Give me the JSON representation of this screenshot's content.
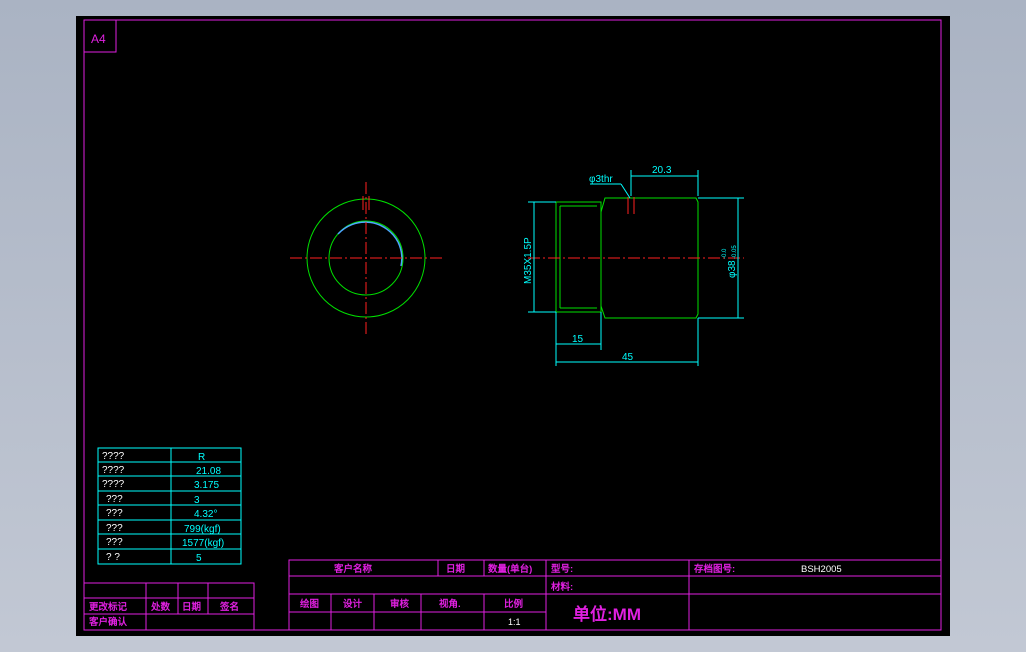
{
  "sheet": {
    "size_label": "A4"
  },
  "drawing": {
    "dim_thread_hole": "φ3thr",
    "dim_offset": "20.3",
    "dim_thread": "M35X1.5P",
    "dim_diameter": "φ38",
    "dim_tol_upper": "-0.0",
    "dim_tol_lower": "-0.05",
    "dim_len_small": "15",
    "dim_len_total": "45"
  },
  "spec_table": {
    "rows": [
      {
        "label": "????",
        "value": "R"
      },
      {
        "label": "????",
        "value": "21.08"
      },
      {
        "label": "????",
        "value": "3.175"
      },
      {
        "label": "???",
        "value": "3"
      },
      {
        "label": "???",
        "value": "4.32°"
      },
      {
        "label": "???",
        "value": "799(kgf)"
      },
      {
        "label": "???",
        "value": "1577(kgf)"
      },
      {
        "label": "?    ?",
        "value": "5"
      }
    ]
  },
  "title_block": {
    "customer_name": "客户名称",
    "date": "日期",
    "quantity": "数量(单台)",
    "model": "型号:",
    "archive": "存档图号:",
    "archive_value": "BSH2005",
    "material": "材料:",
    "drawn": "绘图",
    "design": "设计",
    "review": "审核",
    "view_angle": "视角.",
    "scale": "比例",
    "scale_value": "1:1",
    "unit": "单位:MM"
  },
  "revision_block": {
    "change_mark": "更改标记",
    "location": "处数",
    "date": "日期",
    "sign": "签名",
    "customer_confirm": "客户确认"
  }
}
